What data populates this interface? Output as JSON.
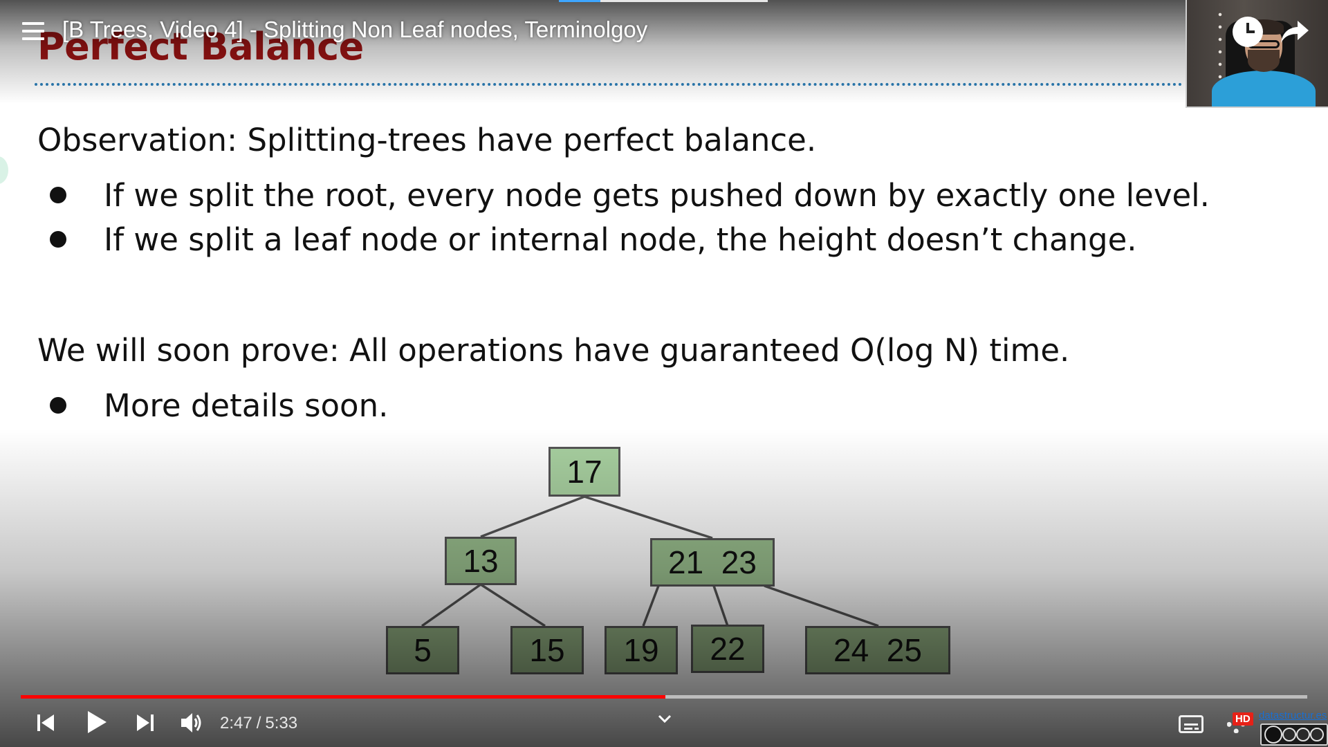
{
  "video": {
    "title": "[B Trees, Video 4] - Splitting Non Leaf nodes, Terminolgoy",
    "current_time": "2:47",
    "duration": "5:33",
    "progress_fraction": 0.501,
    "progress_color": "#ff0000",
    "hd_badge": "HD",
    "site_link": "datastructur.es"
  },
  "slide": {
    "title": "Perfect Balance",
    "title_color": "#a31515",
    "rule_color": "#2d7fb8",
    "observation": "Observation: Splitting-trees have perfect balance.",
    "bullets_1": [
      "If we split the root, every node gets pushed down by exactly one level.",
      "If we split a leaf node or internal node, the height doesn’t change."
    ],
    "prove": "We will soon prove: All operations have guaranteed O(log N) time.",
    "bullets_2": [
      "More details soon."
    ]
  },
  "tree": {
    "root": {
      "keys": "17",
      "fill": "#a8d0a0"
    },
    "level1": [
      {
        "keys": "13",
        "fill": "#9abf8e"
      },
      {
        "keys": "21  23",
        "fill": "#9abf8e"
      }
    ],
    "leaves": [
      {
        "keys": "5",
        "fill": "#93b183"
      },
      {
        "keys": "15",
        "fill": "#93b183"
      },
      {
        "keys": "19",
        "fill": "#93b183"
      },
      {
        "keys": "22",
        "fill": "#93b183"
      },
      {
        "keys": "24  25",
        "fill": "#93b183"
      }
    ]
  },
  "icons": {
    "menu": "menu-icon",
    "clock": "watch-later-icon",
    "share": "share-icon",
    "prev": "previous-icon",
    "play": "play-icon",
    "next": "next-icon",
    "volume": "volume-icon",
    "chevron": "chevron-down-icon",
    "subtitles": "subtitles-icon",
    "settings": "settings-icon",
    "license": "cc-by-nc-sa-icon"
  }
}
